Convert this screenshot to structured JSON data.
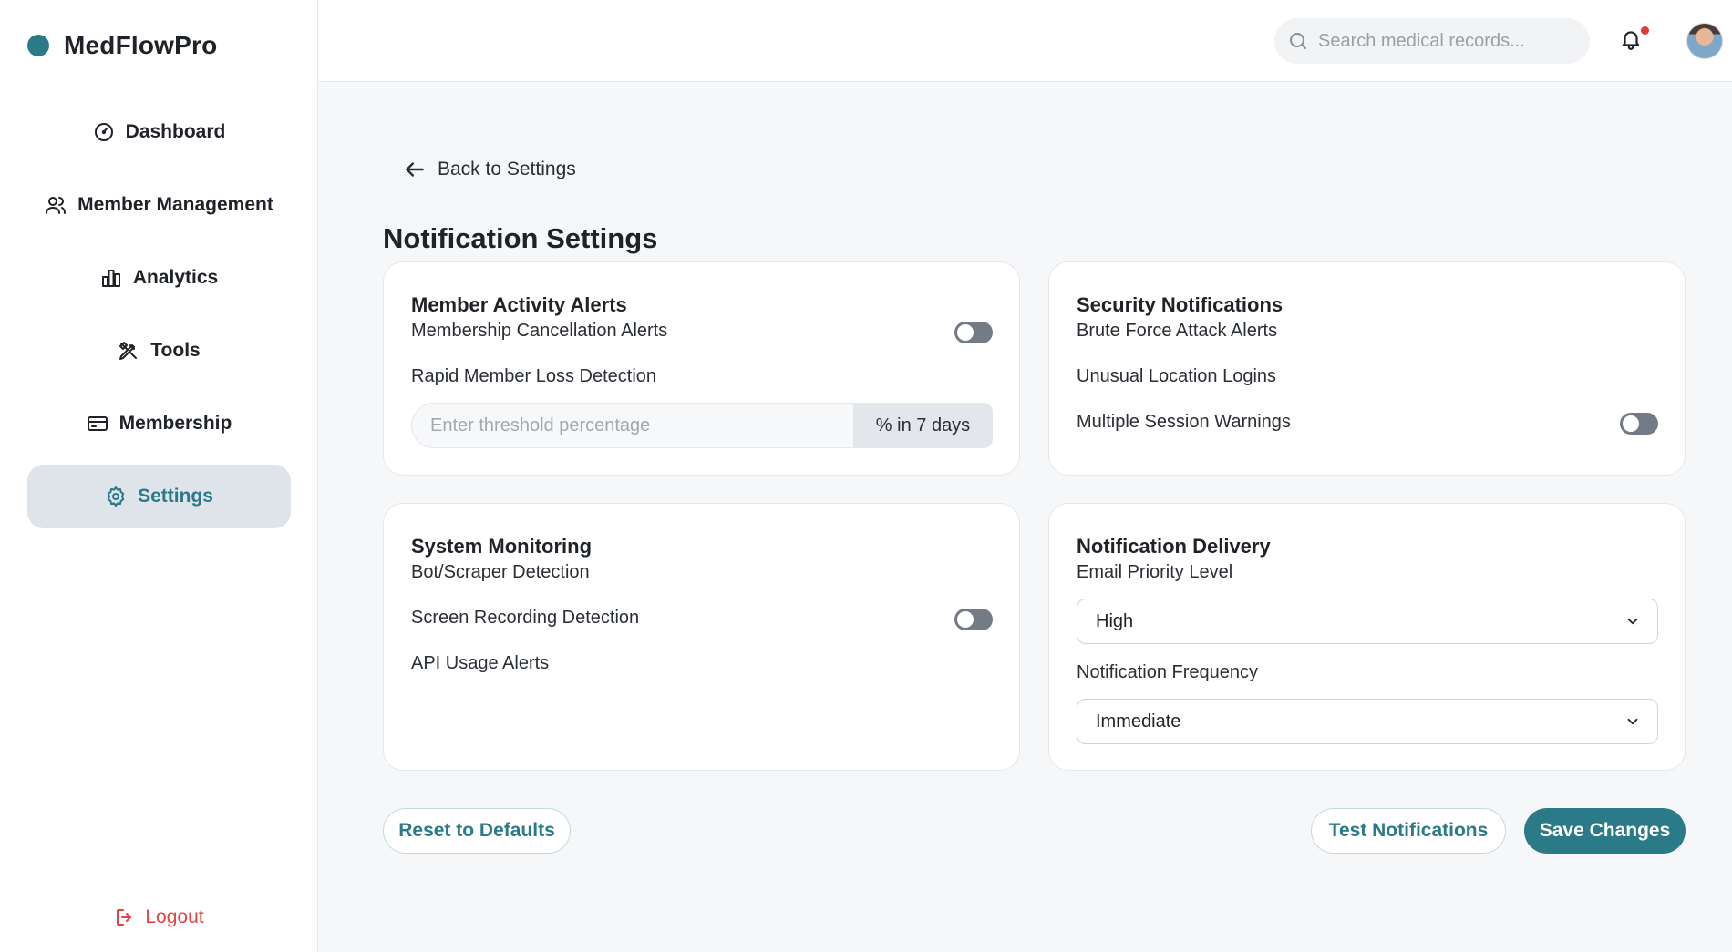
{
  "brand": {
    "name": "MedFlowPro",
    "accent": "#2b7a87"
  },
  "sidebar": {
    "items": [
      {
        "label": "Dashboard",
        "icon": "gauge-icon"
      },
      {
        "label": "Member Management",
        "icon": "users-icon"
      },
      {
        "label": "Analytics",
        "icon": "bar-chart-icon"
      },
      {
        "label": "Tools",
        "icon": "tools-icon"
      },
      {
        "label": "Membership",
        "icon": "card-icon"
      },
      {
        "label": "Settings",
        "icon": "gear-icon",
        "active": true
      }
    ],
    "logout_label": "Logout"
  },
  "header": {
    "search_placeholder": "Search medical records...",
    "has_notification": true
  },
  "page": {
    "back_label": "Back to Settings",
    "title": "Notification Settings"
  },
  "cards": {
    "member_activity": {
      "title": "Member Activity Alerts",
      "cancellation_label": "Membership Cancellation Alerts",
      "cancellation_enabled": false,
      "rapid_loss_label": "Rapid Member Loss Detection",
      "threshold_placeholder": "Enter threshold percentage",
      "threshold_suffix": "% in 7 days"
    },
    "security": {
      "title": "Security Notifications",
      "brute_force_label": "Brute Force Attack Alerts",
      "unusual_location_label": "Unusual Location Logins",
      "multi_session_label": "Multiple Session Warnings",
      "multi_session_enabled": false
    },
    "system": {
      "title": "System Monitoring",
      "bot_label": "Bot/Scraper Detection",
      "screen_recording_label": "Screen Recording Detection",
      "screen_recording_enabled": false,
      "api_label": "API Usage Alerts"
    },
    "delivery": {
      "title": "Notification Delivery",
      "email_priority_label": "Email Priority Level",
      "email_priority_value": "High",
      "frequency_label": "Notification Frequency",
      "frequency_value": "Immediate"
    }
  },
  "actions": {
    "reset_label": "Reset to Defaults",
    "test_label": "Test Notifications",
    "save_label": "Save Changes"
  }
}
